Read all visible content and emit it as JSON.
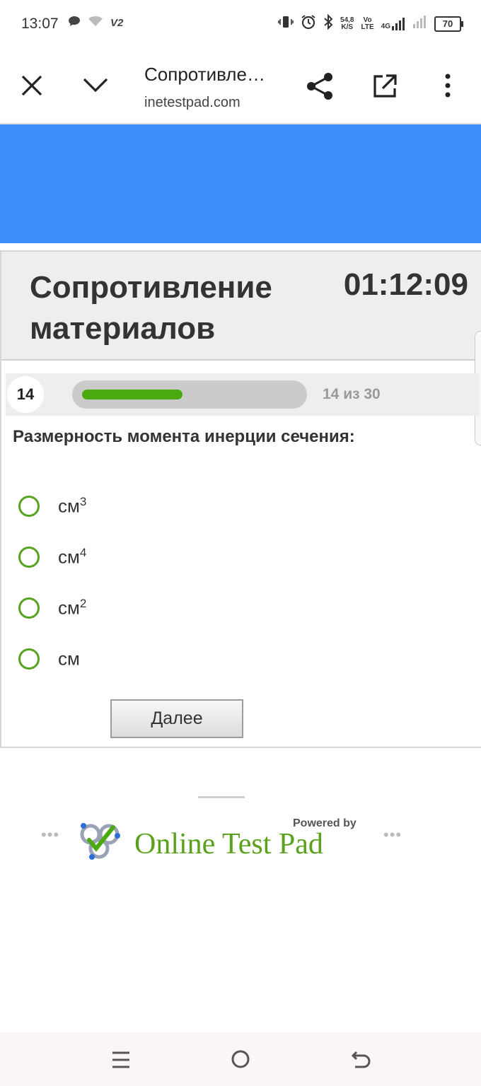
{
  "status_bar": {
    "time": "13:07",
    "carrier_tag": "V2",
    "speed_value": "54,8",
    "speed_unit": "K/S",
    "volte_top": "Vo",
    "volte_bottom": "LTE",
    "network": "4G",
    "battery": "70"
  },
  "browser": {
    "tab_title": "Сопротивле…",
    "url": "inetestpad.com"
  },
  "test": {
    "title": "Сопротивление материалов",
    "timer": "01:12:09",
    "question_number": "14",
    "progress_text": "14 из 30",
    "progress": {
      "current": 14,
      "total": 30
    },
    "question": "Размерность момента инерции сечения:",
    "options": [
      {
        "base": "см",
        "sup": "3"
      },
      {
        "base": "см",
        "sup": "4"
      },
      {
        "base": "см",
        "sup": "2"
      },
      {
        "base": "см",
        "sup": ""
      }
    ],
    "next_label": "Далее"
  },
  "footer": {
    "powered_by": "Powered by",
    "brand": "Online Test Pad"
  },
  "colors": {
    "banner": "#3d8ef8",
    "accent_green": "#4caa11",
    "radio_green": "#58a321"
  }
}
